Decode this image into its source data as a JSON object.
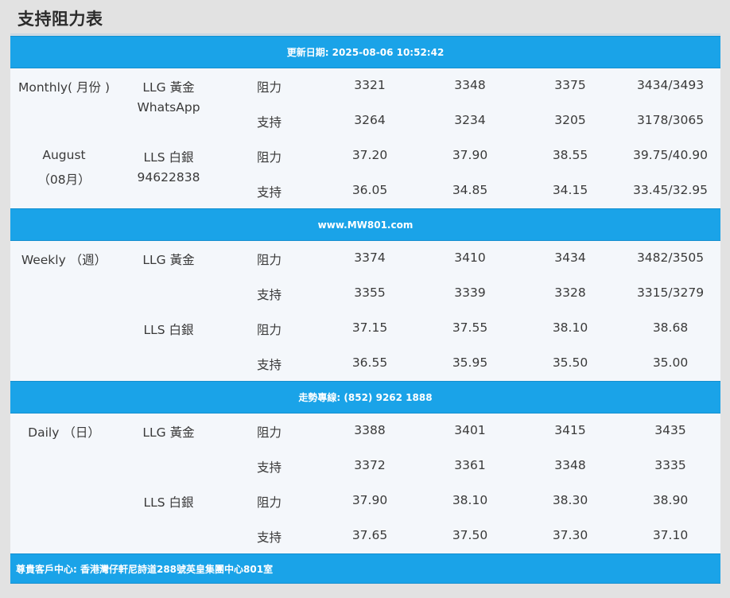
{
  "page_title": "支持阻力表",
  "update_bar": "更新日期: 2025-08-06 10:52:42",
  "site_bar": "www.MW801.com",
  "hotline_bar": "走勢專線: (852) 9262 1888",
  "footer_bar": "尊貴客戶中心: 香港灣仔軒尼詩道288號英皇集團中心801室",
  "sections": [
    {
      "period_line1": "Monthly( 月份 )",
      "period_line2": "August",
      "period_line3": "（08月）",
      "products": [
        {
          "name_line1": "LLG 黃金",
          "name_line2": "WhatsApp",
          "rows": [
            {
              "type": "阻力",
              "v": [
                "3321",
                "3348",
                "3375",
                "3434/3493"
              ]
            },
            {
              "type": "支持",
              "v": [
                "3264",
                "3234",
                "3205",
                "3178/3065"
              ]
            }
          ]
        },
        {
          "name_line1": "LLS 白銀",
          "name_line2": "94622838",
          "rows": [
            {
              "type": "阻力",
              "v": [
                "37.20",
                "37.90",
                "38.55",
                "39.75/40.90"
              ]
            },
            {
              "type": "支持",
              "v": [
                "36.05",
                "34.85",
                "34.15",
                "33.45/32.95"
              ]
            }
          ]
        }
      ]
    },
    {
      "period_line1": "Weekly （週）",
      "products": [
        {
          "name_line1": "LLG 黃金",
          "rows": [
            {
              "type": "阻力",
              "v": [
                "3374",
                "3410",
                "3434",
                "3482/3505"
              ]
            },
            {
              "type": "支持",
              "v": [
                "3355",
                "3339",
                "3328",
                "3315/3279"
              ]
            }
          ]
        },
        {
          "name_line1": "LLS 白銀",
          "rows": [
            {
              "type": "阻力",
              "v": [
                "37.15",
                "37.55",
                "38.10",
                "38.68"
              ]
            },
            {
              "type": "支持",
              "v": [
                "36.55",
                "35.95",
                "35.50",
                "35.00"
              ]
            }
          ]
        }
      ]
    },
    {
      "period_line1": "Daily （日）",
      "products": [
        {
          "name_line1": "LLG 黃金",
          "rows": [
            {
              "type": "阻力",
              "v": [
                "3388",
                "3401",
                "3415",
                "3435"
              ]
            },
            {
              "type": "支持",
              "v": [
                "3372",
                "3361",
                "3348",
                "3335"
              ]
            }
          ]
        },
        {
          "name_line1": "LLS 白銀",
          "rows": [
            {
              "type": "阻力",
              "v": [
                "37.90",
                "38.10",
                "38.30",
                "38.90"
              ]
            },
            {
              "type": "支持",
              "v": [
                "37.65",
                "37.50",
                "37.30",
                "37.10"
              ]
            }
          ]
        }
      ]
    }
  ]
}
